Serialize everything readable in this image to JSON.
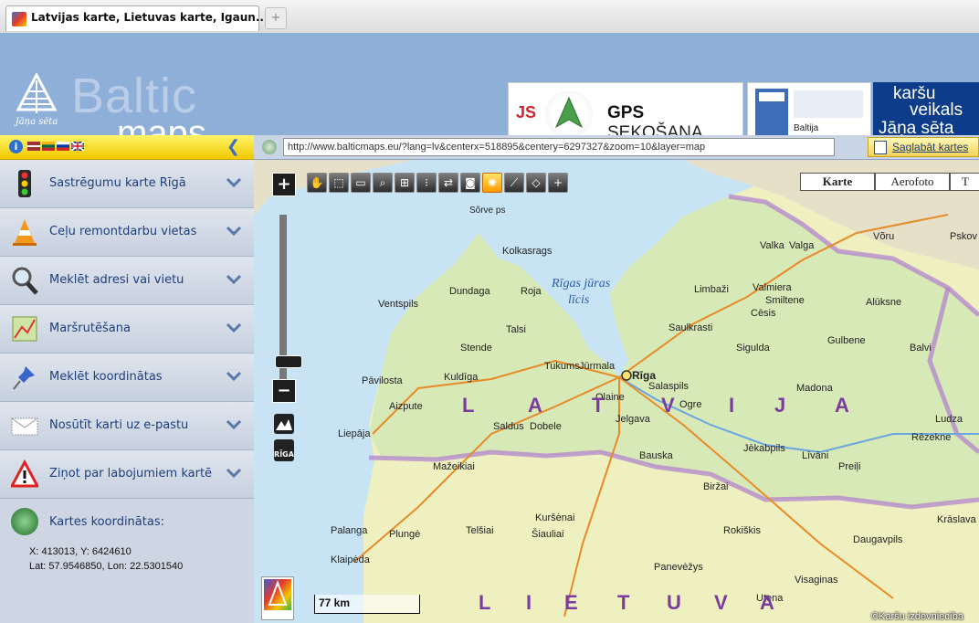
{
  "browser": {
    "tab_title": "Latvijas karte, Lietuvas karte, Igaun...",
    "new_tab": "+"
  },
  "header": {
    "logo_word_1": "Baltic",
    "logo_word_2": "maps",
    "logo_tagline": "Jāņa sēta",
    "ad_gps": {
      "brand": "JS",
      "text_bold": "GPS",
      "text_rest": " SEKOŠANA"
    },
    "ad_box": {
      "label": "Baltija"
    },
    "ad_shop": {
      "line1": "karšu",
      "line2": "veikals",
      "line3": "Jāņa sēta"
    }
  },
  "sidebar": {
    "info": "i",
    "collapse": "❮",
    "items": [
      {
        "label": "Sastrēgumu karte Rīgā",
        "icon": "traffic-light-icon"
      },
      {
        "label": "Ceļu remontdarbu vietas",
        "icon": "traffic-cone-icon"
      },
      {
        "label": "Meklēt adresi vai vietu",
        "icon": "magnifier-icon"
      },
      {
        "label": "Maršrutēšana",
        "icon": "route-map-icon"
      },
      {
        "label": "Meklēt koordinātas",
        "icon": "pushpin-icon"
      },
      {
        "label": "Nosūtīt karti uz e-pastu",
        "icon": "envelope-icon"
      },
      {
        "label": "Ziņot par labojumiem kartē",
        "icon": "warning-icon"
      }
    ],
    "coords": {
      "title": "Kartes koordinātas:",
      "xy": "X: 413013, Y: 6424610",
      "latlon": "Lat: 57.9546850, Lon: 22.5301540"
    }
  },
  "urlbar": {
    "url": "http://www.balticmaps.eu/?lang=lv&centerx=518895&centery=6297327&zoom=10&layer=map",
    "save_label": "Saglabāt kartes"
  },
  "map": {
    "layer_tabs": [
      "Karte",
      "Aerofoto",
      "T"
    ],
    "scale": "77 km",
    "copyright": "©Karšu izdevniecība",
    "zoom_in": "+",
    "zoom_out": "−",
    "riga_button": "RĪGA",
    "labels": {
      "sea": "Rīgas jūras",
      "sea2": "līcis",
      "sorve": "Sõrve ps",
      "riga": "Rīga",
      "ventspils": "Ventspils",
      "liepaja": "Liepāja",
      "jelgava": "Jelgava",
      "jurmala": "Jūrmala",
      "kuldiga": "Kuldīga",
      "talsi": "Talsi",
      "tukums": "Tukums",
      "sigulda": "Sigulda",
      "cesis": "Cēsis",
      "valmiera": "Valmiera",
      "valga": "Valga",
      "voru": "Võru",
      "pskov": "Pskov",
      "bauska": "Bauska",
      "saldus": "Saldus",
      "dobele": "Dobele",
      "ogre": "Ogre",
      "daugavpils": "Daugavpils",
      "rezekne": "Rēzekne",
      "siauliai": "Šiauliai",
      "panevezys": "Panevėžys",
      "klaipeda": "Klaipėda",
      "palanga": "Palanga",
      "plunge": "Plungė",
      "telsiai": "Telšiai",
      "birzai": "Biržai",
      "kursenai": "Kuršėnai",
      "rokiskis": "Rokiškis",
      "utena": "Utena",
      "ludza": "Ludza",
      "madona": "Madona",
      "jekabpils": "Jēkabpils",
      "visaginas": "Visaginas",
      "kraslava": "Krāslava",
      "mazeikiai": "Mažeikiai",
      "salaspils": "Salaspils",
      "limbazi": "Limbaži",
      "saulkrasti": "Saulkrasti",
      "kolka": "Kolkasrags",
      "dundaga": "Dundaga",
      "roja": "Roja",
      "stende": "Stende",
      "pavilosta": "Pāvilosta",
      "aizpute": "Aizpute",
      "olaine": "Olaine",
      "livani": "Līvāni",
      "preili": "Preiļi",
      "gulbene": "Gulbene",
      "aluksne": "Alūksne",
      "balvi": "Balvi",
      "smiltene": "Smiltene",
      "valka": "Valka",
      "latvija_letters": [
        "L",
        "A",
        "T",
        "V",
        "I",
        "J",
        "A"
      ],
      "lietuva_letters": [
        "L",
        "I",
        "E",
        "T",
        "U",
        "V",
        "A"
      ]
    }
  }
}
